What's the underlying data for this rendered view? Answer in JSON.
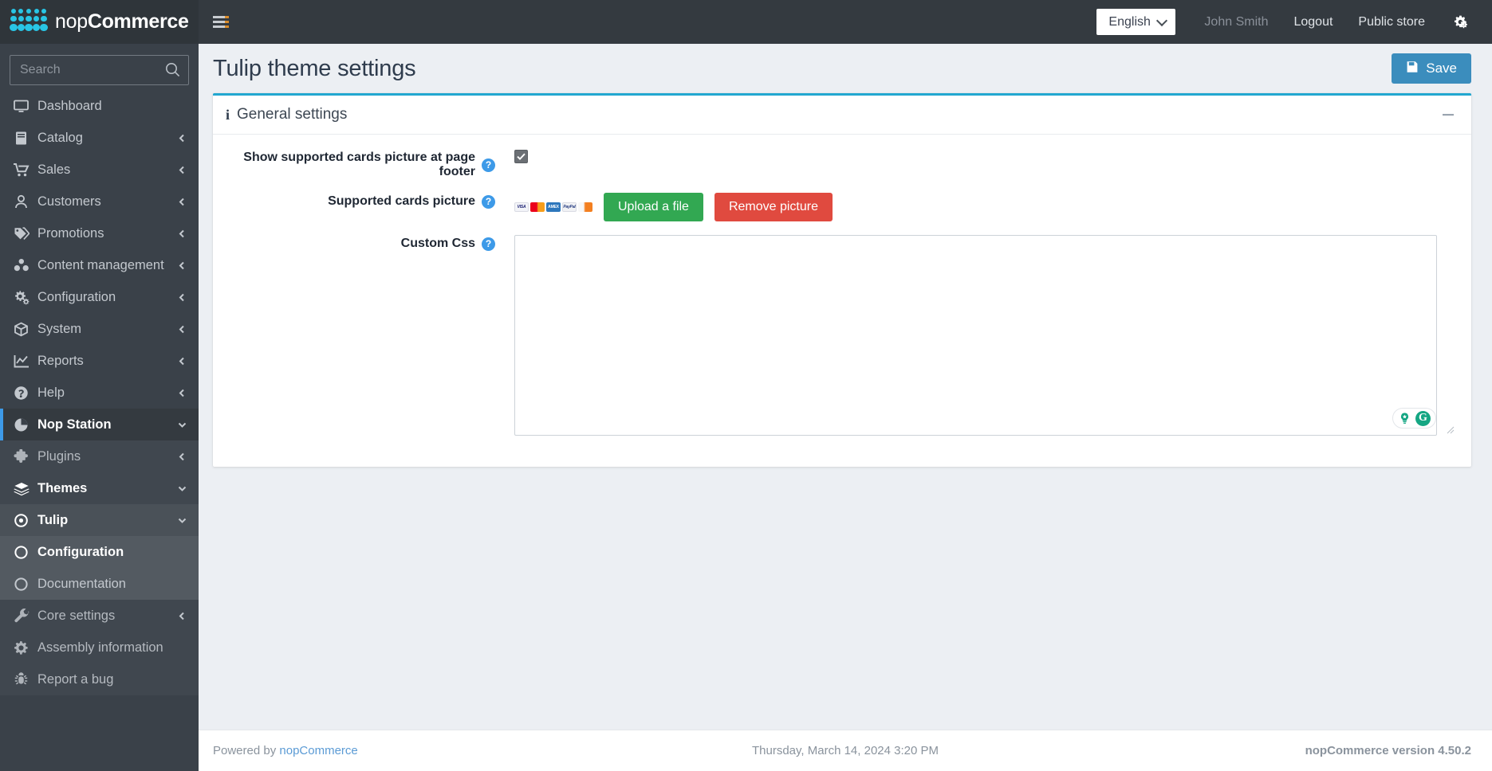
{
  "brand": {
    "prefix": "nop",
    "bold": "Commerce"
  },
  "topnav": {
    "hamburger_name": "menu-toggle",
    "language": {
      "selected": "English",
      "options": [
        "English"
      ]
    },
    "user": "John Smith",
    "logout": "Logout",
    "public_store": "Public store",
    "settings_icon": "gears-icon"
  },
  "sidebar": {
    "search_placeholder": "Search",
    "items": [
      {
        "label": "Dashboard",
        "icon": "monitor-icon",
        "level": 1,
        "caret": "",
        "state": ""
      },
      {
        "label": "Catalog",
        "icon": "book-icon",
        "level": 1,
        "caret": "left",
        "state": ""
      },
      {
        "label": "Sales",
        "icon": "cart-icon",
        "level": 1,
        "caret": "left",
        "state": ""
      },
      {
        "label": "Customers",
        "icon": "user-icon",
        "level": 1,
        "caret": "left",
        "state": ""
      },
      {
        "label": "Promotions",
        "icon": "tags-icon",
        "level": 1,
        "caret": "left",
        "state": ""
      },
      {
        "label": "Content management",
        "icon": "cubes-icon",
        "level": 1,
        "caret": "left",
        "state": ""
      },
      {
        "label": "Configuration",
        "icon": "gears-icon",
        "level": 1,
        "caret": "left",
        "state": ""
      },
      {
        "label": "System",
        "icon": "box-icon",
        "level": 1,
        "caret": "left",
        "state": ""
      },
      {
        "label": "Reports",
        "icon": "chart-icon",
        "level": 1,
        "caret": "left",
        "state": ""
      },
      {
        "label": "Help",
        "icon": "question-icon",
        "level": 1,
        "caret": "left",
        "state": ""
      },
      {
        "label": "Nop Station",
        "icon": "pie-icon",
        "level": 1,
        "caret": "down",
        "state": "active-parent"
      },
      {
        "label": "Plugins",
        "icon": "puzzle-icon",
        "level": 2,
        "caret": "left",
        "state": ""
      },
      {
        "label": "Themes",
        "icon": "layers-icon",
        "level": 2,
        "caret": "down",
        "state": "bold"
      },
      {
        "label": "Tulip",
        "icon": "dot-circle-icon",
        "level": 3,
        "caret": "down",
        "state": "bold"
      },
      {
        "label": "Configuration",
        "icon": "circle-icon",
        "level": 4,
        "caret": "",
        "state": "bold"
      },
      {
        "label": "Documentation",
        "icon": "circle-icon",
        "level": 4,
        "caret": "",
        "state": ""
      },
      {
        "label": "Core settings",
        "icon": "wrench-icon",
        "level": 2,
        "caret": "left",
        "state": ""
      },
      {
        "label": "Assembly information",
        "icon": "gear-icon",
        "level": 2,
        "caret": "",
        "state": ""
      },
      {
        "label": "Report a bug",
        "icon": "bug-icon",
        "level": 2,
        "caret": "",
        "state": ""
      }
    ]
  },
  "page": {
    "title": "Tulip theme settings",
    "save_label": "Save",
    "accent_color": "#22a7d0",
    "save_color": "#3b8dbd"
  },
  "card": {
    "title": "General settings",
    "collapse_icon": "minus-icon"
  },
  "form": {
    "show_cards": {
      "label": "Show supported cards picture at page footer",
      "help": "?",
      "checked": true
    },
    "supported_cards": {
      "label": "Supported cards picture",
      "help": "?",
      "cards": [
        "VISA",
        "MC",
        "AMEX",
        "PayPal",
        "DISC"
      ],
      "upload_label": "Upload a file",
      "remove_label": "Remove picture",
      "upload_color": "#32a852",
      "remove_color": "#e04a3f"
    },
    "custom_css": {
      "label": "Custom Css",
      "help": "?",
      "value": "",
      "placeholder": ""
    }
  },
  "grammarly": {
    "bulb_icon": "lightbulb-icon",
    "logo_text": "G"
  },
  "footer": {
    "powered_by": "Powered by ",
    "powered_link": "nopCommerce",
    "datetime": "Thursday, March 14, 2024 3:20 PM",
    "version": "nopCommerce version 4.50.2"
  }
}
